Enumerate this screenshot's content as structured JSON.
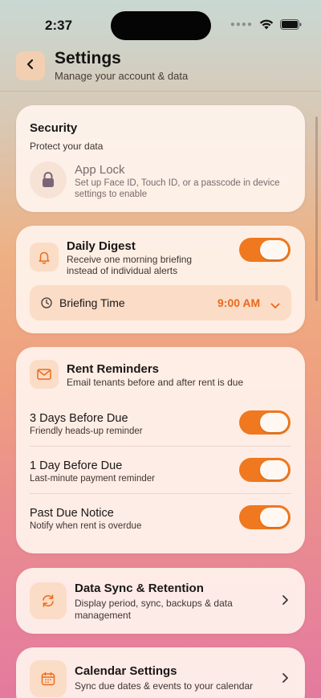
{
  "status_bar": {
    "time": "2:37"
  },
  "header": {
    "title": "Settings",
    "subtitle": "Manage your account & data"
  },
  "security": {
    "title": "Security",
    "subtitle": "Protect your data",
    "app_lock": {
      "title": "App Lock",
      "description": "Set up Face ID, Touch ID, or a passcode in device settings to enable",
      "icon": "lock-icon"
    }
  },
  "daily_digest": {
    "title": "Daily Digest",
    "description": "Receive one morning briefing instead of individual alerts",
    "enabled": true,
    "icon": "bell-icon",
    "briefing_time_label": "Briefing Time",
    "briefing_time_value": "9:00 AM"
  },
  "rent_reminders": {
    "title": "Rent Reminders",
    "description": "Email tenants before and after rent is due",
    "icon": "envelope-icon",
    "items": [
      {
        "title": "3 Days Before Due",
        "subtitle": "Friendly heads-up reminder",
        "enabled": true
      },
      {
        "title": "1 Day Before Due",
        "subtitle": "Last-minute payment reminder",
        "enabled": true
      },
      {
        "title": "Past Due Notice",
        "subtitle": "Notify when rent is overdue",
        "enabled": true
      }
    ]
  },
  "data_sync": {
    "title": "Data Sync & Retention",
    "description": "Display period, sync, backups & data management",
    "icon": "sync-icon"
  },
  "calendar": {
    "title": "Calendar Settings",
    "description": "Sync due dates & events to your calendar",
    "icon": "calendar-icon"
  },
  "colors": {
    "accent": "#F0781E",
    "icon_tile": "#FBDCC6",
    "card": "#FFF4EE"
  }
}
